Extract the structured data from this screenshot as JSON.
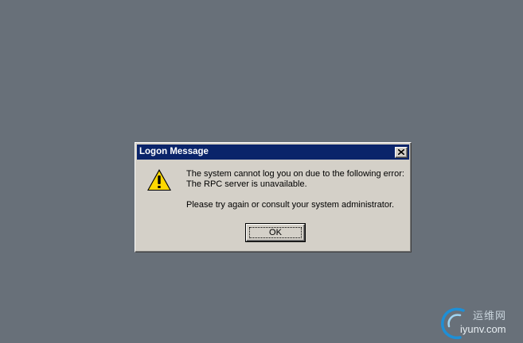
{
  "dialog": {
    "title": "Logon Message",
    "close_glyph": "✕",
    "icon": "warning-icon",
    "message_lines": [
      "The system cannot log you on due to the following error:",
      "The RPC server is unavailable."
    ],
    "hint": "Please try again or consult your system administrator.",
    "ok_label": "OK"
  },
  "watermark": {
    "cn_text": "运维网",
    "en_text": "iyunv.com"
  },
  "colors": {
    "desktop": "#687079",
    "title_bar": "#0a246a",
    "dialog_face": "#d4d0c8",
    "warning_yellow": "#ffd800"
  }
}
